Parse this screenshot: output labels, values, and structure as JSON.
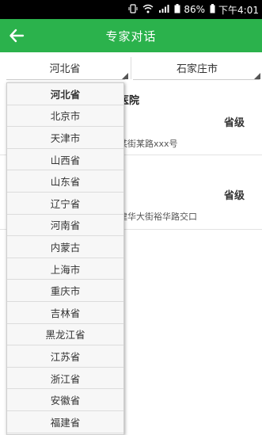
{
  "status_bar": {
    "battery": "86%",
    "time": "下午4:01",
    "icons": [
      "vibrate-icon",
      "wifi-icon",
      "signal-icon",
      "battery-icon"
    ]
  },
  "app_bar": {
    "title": "专家对话",
    "back_icon": "back-arrow-icon"
  },
  "filters": {
    "province": "河北省",
    "city": "石家庄市"
  },
  "hospitals": [
    {
      "name": "医院",
      "level": "省级",
      "address": "某街某路xxx号"
    },
    {
      "name": "",
      "level": "省级",
      "address": "建华大街裕华路交口"
    }
  ],
  "province_dropdown": {
    "selected": "河北省",
    "options": [
      "河北省",
      "北京市",
      "天津市",
      "山西省",
      "山东省",
      "辽宁省",
      "河南省",
      "内蒙古",
      "上海市",
      "重庆市",
      "吉林省",
      "黑龙江省",
      "江苏省",
      "浙江省",
      "安徽省",
      "福建省"
    ]
  },
  "colors": {
    "accent": "#2bb24c",
    "status_bar": "#000000"
  }
}
